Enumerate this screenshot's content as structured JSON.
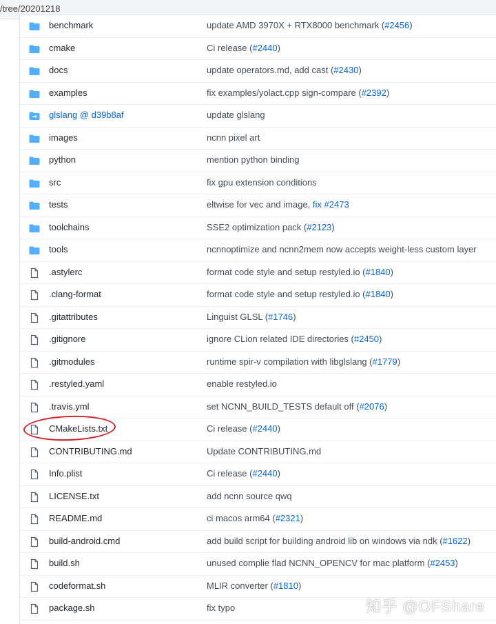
{
  "address_bar": {
    "url": "/tree/20201218"
  },
  "rows": [
    {
      "type": "folder",
      "name": "benchmark",
      "msg": "update AMD 3970X + RTX8000 benchmark (",
      "issue": "#2456",
      "end": ")"
    },
    {
      "type": "folder",
      "name": "cmake",
      "msg": "Ci release (",
      "issue": "#2440",
      "end": ")"
    },
    {
      "type": "folder",
      "name": "docs",
      "msg": "update operators.md, add cast (",
      "issue": "#2430",
      "end": ")"
    },
    {
      "type": "folder",
      "name": "examples",
      "msg": "fix examples/yolact.cpp sign-compare (",
      "issue": "#2392",
      "end": ")"
    },
    {
      "type": "submodule",
      "name": "glslang @ d39b8af",
      "msg": "update glslang",
      "issue": "",
      "end": ""
    },
    {
      "type": "folder",
      "name": "images",
      "msg": "ncnn pixel art",
      "issue": "",
      "end": ""
    },
    {
      "type": "folder",
      "name": "python",
      "msg": "mention python binding",
      "issue": "",
      "end": ""
    },
    {
      "type": "folder",
      "name": "src",
      "msg": "fix gpu extension conditions",
      "issue": "",
      "end": ""
    },
    {
      "type": "folder",
      "name": "tests",
      "msg": "eltwise for vec and image, ",
      "issue": "fix #2473",
      "end": ""
    },
    {
      "type": "folder",
      "name": "toolchains",
      "msg": "SSE2 optimization pack (",
      "issue": "#2123",
      "end": ")"
    },
    {
      "type": "folder",
      "name": "tools",
      "msg": "ncnnoptimize and ncnn2mem now accepts weight-less custom layer",
      "issue": "",
      "end": ""
    },
    {
      "type": "file",
      "name": ".astylerc",
      "msg": "format code style and setup restyled.io (",
      "issue": "#1840",
      "end": ")"
    },
    {
      "type": "file",
      "name": ".clang-format",
      "msg": "format code style and setup restyled.io (",
      "issue": "#1840",
      "end": ")"
    },
    {
      "type": "file",
      "name": ".gitattributes",
      "msg": "Linguist GLSL (",
      "issue": "#1746",
      "end": ")"
    },
    {
      "type": "file",
      "name": ".gitignore",
      "msg": "ignore CLion related IDE directories (",
      "issue": "#2450",
      "end": ")"
    },
    {
      "type": "file",
      "name": ".gitmodules",
      "msg": "runtime spir-v compilation with libglslang (",
      "issue": "#1779",
      "end": ")"
    },
    {
      "type": "file",
      "name": ".restyled.yaml",
      "msg": "enable restyled.io",
      "issue": "",
      "end": ""
    },
    {
      "type": "file",
      "name": ".travis.yml",
      "msg": "set NCNN_BUILD_TESTS default off (",
      "issue": "#2076",
      "end": ")"
    },
    {
      "type": "file",
      "name": "CMakeLists.txt",
      "msg": "Ci release (",
      "issue": "#2440",
      "end": ")"
    },
    {
      "type": "file",
      "name": "CONTRIBUTING.md",
      "msg": "Update CONTRIBUTING.md",
      "issue": "",
      "end": ""
    },
    {
      "type": "file",
      "name": "Info.plist",
      "msg": "Ci release (",
      "issue": "#2440",
      "end": ")"
    },
    {
      "type": "file",
      "name": "LICENSE.txt",
      "msg": "add ncnn source qwq",
      "issue": "",
      "end": ""
    },
    {
      "type": "file",
      "name": "README.md",
      "msg": "ci macos arm64 (",
      "issue": "#2321",
      "end": ")"
    },
    {
      "type": "file",
      "name": "build-android.cmd",
      "msg": "add build script for building android lib on windows via ndk (",
      "issue": "#1622",
      "end": ")"
    },
    {
      "type": "file",
      "name": "build.sh",
      "msg": "unused complie flad NCNN_OPENCV for mac platform (",
      "issue": "#2453",
      "end": ")"
    },
    {
      "type": "file",
      "name": "codeformat.sh",
      "msg": "MLIR converter (",
      "issue": "#1810",
      "end": ")"
    },
    {
      "type": "file",
      "name": "package.sh",
      "msg": "fix typo",
      "issue": "",
      "end": ""
    }
  ],
  "watermark": "知乎 @OFShare",
  "colors": {
    "folder": "#54aeff",
    "file": "#57606a",
    "link": "#0366d6",
    "highlight_circle": "#d5202a"
  }
}
